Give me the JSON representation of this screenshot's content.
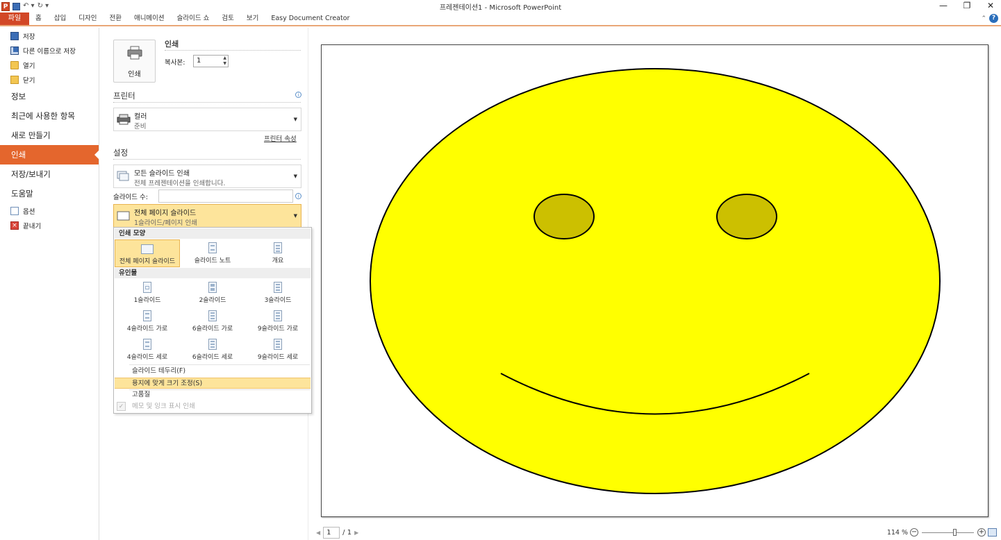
{
  "window": {
    "title": "프레젠테이션1 - Microsoft PowerPoint",
    "logo_letter": "P",
    "controls": [
      "—",
      "❐",
      "✕"
    ]
  },
  "ribbon": {
    "file_tab": "파일",
    "tabs": [
      "홈",
      "삽입",
      "디자인",
      "전환",
      "애니메이션",
      "슬라이드 쇼",
      "검토",
      "보기",
      "Easy Document Creator"
    ]
  },
  "nav": {
    "small_items": [
      {
        "label": "저장",
        "icon": "save-icon"
      },
      {
        "label": "다른 이름으로 저장",
        "icon": "save-as-icon"
      },
      {
        "label": "열기",
        "icon": "open-folder-icon"
      },
      {
        "label": "닫기",
        "icon": "close-folder-icon"
      }
    ],
    "big_items": [
      "정보",
      "최근에 사용한 항목",
      "새로 만들기",
      "인쇄",
      "저장/보내기",
      "도움말"
    ],
    "active_item": "인쇄",
    "bottom_items": [
      {
        "label": "옵션",
        "icon": "options-icon"
      },
      {
        "label": "끝내기",
        "icon": "exit-icon"
      }
    ]
  },
  "print": {
    "button_label": "인쇄",
    "title": "인쇄",
    "copies_label": "복사본:",
    "copies_value": "1"
  },
  "printer": {
    "section_title": "프린터",
    "name": "컬러",
    "status": "준비",
    "properties_link": "프린터 속성"
  },
  "settings": {
    "section_title": "설정",
    "range_main": "모든 슬라이드 인쇄",
    "range_sub": "전체 프레젠테이션을 인쇄합니다.",
    "slides_label": "슬라이드 수:",
    "slides_value": "",
    "layout_main": "전체 페이지 슬라이드",
    "layout_sub": "1슬라이드/페이지 인쇄"
  },
  "popup": {
    "print_layout_header": "인쇄 모양",
    "print_layouts": [
      "전체 페이지 슬라이드",
      "슬라이드 노트",
      "개요"
    ],
    "handouts_header": "유인물",
    "handouts": [
      "1슬라이드",
      "2슬라이드",
      "3슬라이드",
      "4슬라이드 가로",
      "6슬라이드 가로",
      "9슬라이드 가로",
      "4슬라이드 세로",
      "6슬라이드 세로",
      "9슬라이드 세로"
    ],
    "options": [
      "슬라이드 테두리(F)",
      "용지에 맞게 크기 조정(S)",
      "고품질",
      "메모 및 잉크 표시 인쇄"
    ],
    "check_mark": "✓"
  },
  "preview": {
    "face_color": "#FFFF00",
    "eye_color": "#CCC000",
    "outline_color": "#000000"
  },
  "pager": {
    "current": "1",
    "total": "/ 1",
    "prev": "◀",
    "next": "▶"
  },
  "zoom": {
    "level": "114 %",
    "minus": "−",
    "plus": "+",
    "slider_fraction": 0.62
  }
}
